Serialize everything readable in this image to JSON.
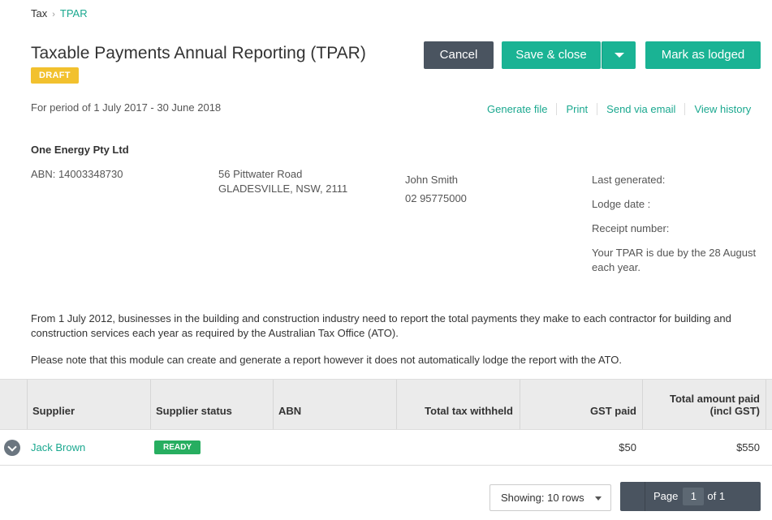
{
  "breadcrumb": {
    "root": "Tax",
    "current": "TPAR"
  },
  "title": "Taxable Payments Annual Reporting (TPAR)",
  "status_badge": "DRAFT",
  "buttons": {
    "cancel": "Cancel",
    "save_close": "Save & close",
    "mark_lodged": "Mark as lodged"
  },
  "period": "For period of 1 July 2017 - 30 June 2018",
  "actions": [
    "Generate file",
    "Print",
    "Send via email",
    "View history"
  ],
  "company": {
    "name": "One Energy Pty Ltd",
    "abn": "ABN: 14003348730",
    "address_line1": "56 Pittwater Road",
    "address_line2": "GLADESVILLE, NSW, 2111",
    "contact_name": "John Smith",
    "contact_phone": "02 95775000"
  },
  "lodgement": {
    "last_generated": "Last generated:",
    "lodge_date": "Lodge date :",
    "receipt_number": "Receipt number:",
    "due_note": "Your TPAR is due by the 28 August each year."
  },
  "notes": [
    "From 1 July 2012, businesses in the building and construction industry need to report the total payments they make to each contractor for building and construction services each year as required by the Australian Tax Office (ATO).",
    "Please note that this module can create and generate a report however it does not automatically lodge the report with the ATO."
  ],
  "table": {
    "columns": [
      "Supplier",
      "Supplier status",
      "ABN",
      "Total tax withheld",
      "GST paid",
      "Total amount paid (incl GST)"
    ],
    "rows": [
      {
        "supplier": "Jack Brown",
        "status": "READY",
        "abn": "",
        "tax_withheld": "",
        "gst_paid": "$50",
        "total_paid": "$550"
      }
    ]
  },
  "pagination": {
    "showing": "Showing: 10 rows",
    "page_label": "Page",
    "page": "1",
    "of": "of 1"
  },
  "colors": {
    "accent": "#1ab394",
    "dark_button": "#4a5460",
    "draft": "#f2c12e",
    "ready": "#27ae60"
  },
  "icons": {
    "breadcrumb_sep": "chevron-right-icon",
    "dropdown": "caret-down-icon",
    "expand": "chevron-down-icon",
    "pager_prev": "chevron-left-icon"
  }
}
